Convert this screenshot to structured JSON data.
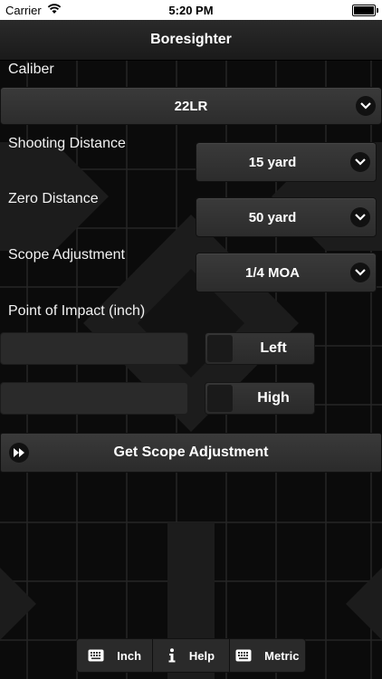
{
  "status_bar": {
    "carrier": "Carrier",
    "time": "5:20 PM"
  },
  "navbar": {
    "title": "Boresighter"
  },
  "caliber": {
    "label": "Caliber",
    "value": "22LR"
  },
  "shooting_distance": {
    "label": "Shooting Distance",
    "value": "15 yard"
  },
  "zero_distance": {
    "label": "Zero Distance",
    "value": "50 yard"
  },
  "scope_adjustment": {
    "label": "Scope Adjustment",
    "value": "1/4 MOA"
  },
  "point_of_impact": {
    "label": "Point of Impact (inch)",
    "horizontal_value": "",
    "horizontal_direction": "Left",
    "vertical_value": "",
    "vertical_direction": "High"
  },
  "action": {
    "label": "Get Scope Adjustment"
  },
  "tabs": [
    {
      "label": "Inch",
      "icon": "keyboard-icon"
    },
    {
      "label": "Help",
      "icon": "info-icon"
    },
    {
      "label": "Metric",
      "icon": "keyboard-icon"
    }
  ],
  "colors": {
    "background": "#0a0a0a",
    "control": "#333333",
    "text": "#ffffff"
  }
}
